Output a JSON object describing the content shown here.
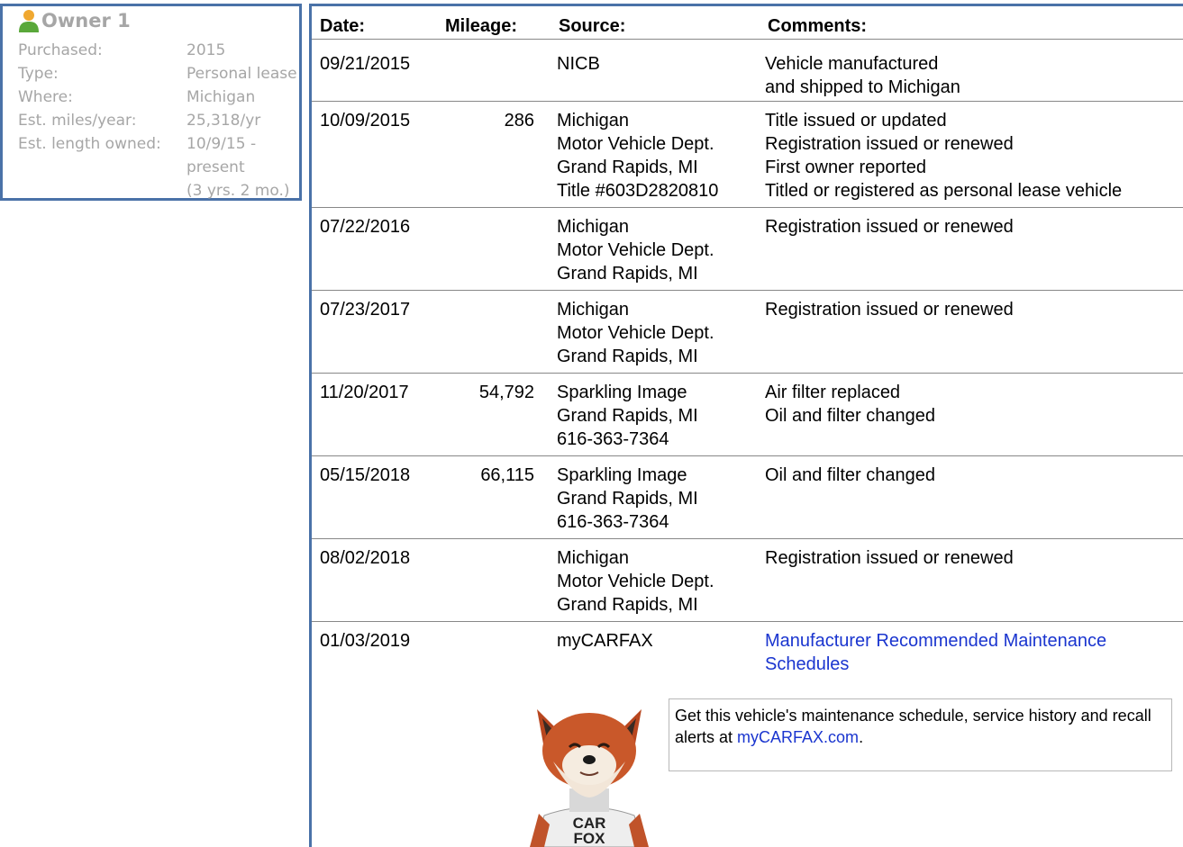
{
  "owner": {
    "title": "Owner 1",
    "rows": [
      {
        "label": "Purchased:",
        "value": [
          "2015"
        ]
      },
      {
        "label": "Type:",
        "value": [
          "Personal lease"
        ]
      },
      {
        "label": "Where:",
        "value": [
          "Michigan"
        ]
      },
      {
        "label": "Est. miles/year:",
        "value": [
          "25,318/yr"
        ]
      },
      {
        "label": "Est. length owned:",
        "value": [
          "10/9/15 -",
          "present",
          "(3 yrs. 2 mo.)"
        ]
      }
    ]
  },
  "history": {
    "headers": {
      "date": "Date:",
      "mileage": "Mileage:",
      "source": "Source:",
      "comments": "Comments:"
    },
    "rows": [
      {
        "date": "09/21/2015",
        "mileage": "",
        "source": [
          "NICB"
        ],
        "comments": [
          "Vehicle manufactured",
          "and shipped to Michigan"
        ]
      },
      {
        "date": "10/09/2015",
        "mileage": "286",
        "source": [
          "Michigan",
          "Motor Vehicle Dept.",
          "Grand Rapids, MI",
          "Title #603D2820810"
        ],
        "comments": [
          "Title issued or updated",
          "Registration issued or renewed",
          "First owner reported",
          "Titled or registered as personal lease vehicle"
        ]
      },
      {
        "date": "07/22/2016",
        "mileage": "",
        "source": [
          "Michigan",
          "Motor Vehicle Dept.",
          "Grand Rapids, MI"
        ],
        "comments": [
          "Registration issued or renewed"
        ]
      },
      {
        "date": "07/23/2017",
        "mileage": "",
        "source": [
          "Michigan",
          "Motor Vehicle Dept.",
          "Grand Rapids, MI"
        ],
        "comments": [
          "Registration issued or renewed"
        ]
      },
      {
        "date": "11/20/2017",
        "mileage": "54,792",
        "source": [
          "Sparkling Image",
          "Grand Rapids, MI",
          "616-363-7364"
        ],
        "comments": [
          "Air filter replaced",
          "Oil and filter changed"
        ]
      },
      {
        "date": "05/15/2018",
        "mileage": "66,115",
        "source": [
          "Sparkling Image",
          "Grand Rapids, MI",
          "616-363-7364"
        ],
        "comments": [
          "Oil and filter changed"
        ]
      },
      {
        "date": "08/02/2018",
        "mileage": "",
        "source": [
          "Michigan",
          "Motor Vehicle Dept.",
          "Grand Rapids, MI"
        ],
        "comments": [
          "Registration issued or renewed"
        ]
      },
      {
        "date": "01/03/2019",
        "mileage": "",
        "source": [
          "myCARFAX"
        ],
        "comments": [
          "Manufacturer Recommended Maintenance",
          "Schedules"
        ],
        "comments_link": true
      }
    ]
  },
  "promo": {
    "text": "Get this vehicle's maintenance schedule, service history and recall alerts at ",
    "link": "myCARFAX.com",
    "suffix": ".",
    "shirt_text": [
      "CAR",
      "FOX"
    ]
  },
  "colors": {
    "accent": "#4a72a8",
    "link": "#1a35cf",
    "muted": "#a6a6a6"
  }
}
